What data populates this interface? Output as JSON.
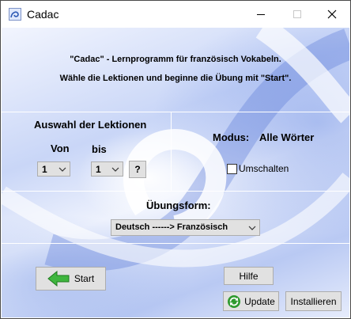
{
  "window": {
    "title": "Cadac"
  },
  "header": {
    "line1": "\"Cadac\" - Lernprogramm für französisch Vokabeln.",
    "line2": "Wähle die Lektionen und beginne die Übung mit \"Start\"."
  },
  "lessons": {
    "heading": "Auswahl der Lektionen",
    "from_label": "Von",
    "to_label": "bis",
    "from_value": "1",
    "to_value": "1",
    "help_label": "?"
  },
  "mode": {
    "label": "Modus:",
    "value": "Alle Wörter",
    "toggle_label": "Umschalten",
    "toggle_checked": false
  },
  "exercise": {
    "label": "Übungsform:",
    "value": "Deutsch ------> Französisch"
  },
  "buttons": {
    "start": "Start",
    "help": "Hilfe",
    "update": "Update",
    "install": "Installieren"
  }
}
